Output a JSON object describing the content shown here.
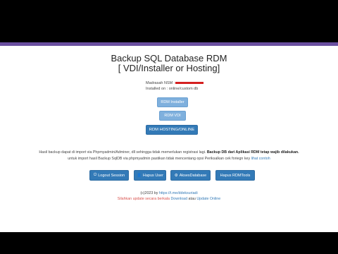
{
  "header": {
    "title_line1": "Backup SQL Database RDM",
    "title_line2": "[ VDI/Installer or Hosting]"
  },
  "meta": {
    "madrasah_label": "Madrasah NSM :",
    "installed_on": "Installed on : online/custom db"
  },
  "buttons": {
    "installer": "RDM Installer",
    "vdi": "RDM VDI",
    "hosting": "RDM HOSTING/ONLINE"
  },
  "info": {
    "line1_prefix": "Hasil backup dapat di import via Phpmyadmin/Adminer, dll sehingga tidak memerlukan registrasi lagi.",
    "line1_bold": "Backup DB dari Aplikasi RDM tetap wajib dilakukan.",
    "line2_text": "untuk import hasil Backup SqlDB via phpmyadmin pastikan tidak mencentang opsi Periksalkan cek foriegn key",
    "line2_link": "lihat contoh"
  },
  "actions": {
    "logout": "Logout Session",
    "hapus_user": "Hapus User",
    "akses_db": "AksesDatabase",
    "hapus_rdm": "Hapus RDMTools"
  },
  "icons": {
    "logout": "power-icon",
    "hapus_user": "user-icon",
    "akses_db": "gear-icon"
  },
  "footer": {
    "copyright": "(c)2023 by",
    "author_link": "https://t.me/ddeksuriadi",
    "update_prefix": "Silahkan update secara berkala",
    "download_link": "Download",
    "atau": "atau",
    "update_link": "Update Online"
  },
  "colors": {
    "accent": "#6a4fa0",
    "button_primary": "#337ab7",
    "button_light": "#7fb0dd",
    "footer_red": "#d9534f"
  }
}
